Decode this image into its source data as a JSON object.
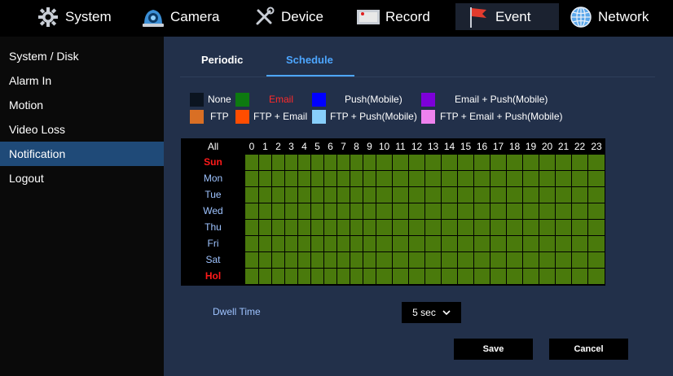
{
  "nav": {
    "items": [
      {
        "label": "System",
        "icon": "gear-icon"
      },
      {
        "label": "Camera",
        "icon": "camera-icon"
      },
      {
        "label": "Device",
        "icon": "tools-icon"
      },
      {
        "label": "Record",
        "icon": "record-icon"
      },
      {
        "label": "Event",
        "icon": "flag-icon"
      },
      {
        "label": "Network",
        "icon": "globe-icon"
      }
    ],
    "active": "Event"
  },
  "sidebar": {
    "items": [
      {
        "label": "System / Disk"
      },
      {
        "label": "Alarm In"
      },
      {
        "label": "Motion"
      },
      {
        "label": "Video Loss"
      },
      {
        "label": "Notification"
      },
      {
        "label": "Logout"
      }
    ],
    "active": "Notification"
  },
  "tabs": {
    "periodic": "Periodic",
    "schedule": "Schedule",
    "active": "Schedule"
  },
  "legend": [
    {
      "label": "None",
      "color": "#0b1420"
    },
    {
      "label": "Email",
      "color": "#0d7a10"
    },
    {
      "label": "Push(Mobile)",
      "color": "#0000ff"
    },
    {
      "label": "Email + Push(Mobile)",
      "color": "#7d00d9"
    },
    {
      "label": "FTP",
      "color": "#d96f24"
    },
    {
      "label": "FTP + Email",
      "color": "#ff4d00"
    },
    {
      "label": "FTP + Push(Mobile)",
      "color": "#87cefa"
    },
    {
      "label": "FTP + Email + Push(Mobile)",
      "color": "#ee82ee"
    }
  ],
  "schedule": {
    "all_label": "All",
    "hours": [
      "0",
      "1",
      "2",
      "3",
      "4",
      "5",
      "6",
      "7",
      "8",
      "9",
      "10",
      "11",
      "12",
      "13",
      "14",
      "15",
      "16",
      "17",
      "18",
      "19",
      "20",
      "21",
      "22",
      "23"
    ],
    "days": [
      "Sun",
      "Mon",
      "Tue",
      "Wed",
      "Thu",
      "Fri",
      "Sat",
      "Hol"
    ],
    "red_days": [
      "Sun",
      "Hol"
    ],
    "cell_mode": "Email",
    "cell_color": "#4a7a0c"
  },
  "dwell": {
    "label": "Dwell Time",
    "value": "5 sec"
  },
  "buttons": {
    "save": "Save",
    "cancel": "Cancel"
  }
}
